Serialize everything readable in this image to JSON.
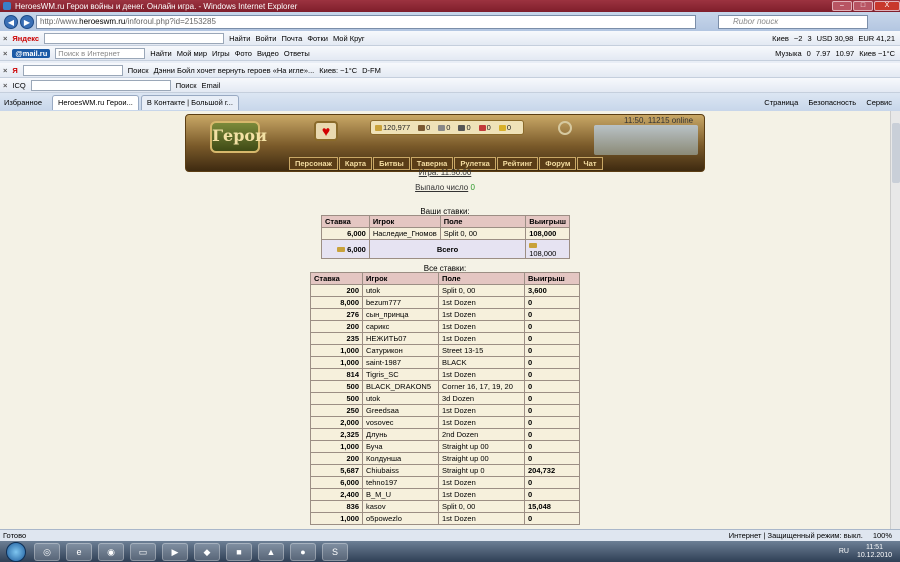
{
  "window": {
    "title": "HeroesWM.ru Герои войны и денег. Онлайн игра. - Windows Internet Explorer",
    "btn_min": "–",
    "btn_max": "□",
    "btn_close": "X"
  },
  "address": {
    "prefix": "http://www.",
    "domain": "heroeswm.ru",
    "path": "/inforoul.php?id=2153285",
    "search_placeholder": "Rubor поиск"
  },
  "toolbar1": {
    "brand": "Яндекс",
    "search_btn": "Найти",
    "items": [
      "Войти",
      "Почта",
      "Фотки",
      "Мой Круг"
    ],
    "weather": "Киев",
    "temp": "−2",
    "count": "3",
    "usd": "USD 30,98",
    "eur": "EUR 41,21"
  },
  "toolbar2": {
    "brand": "@mail.ru",
    "search_placeholder": "Поиск в Интернет",
    "search_btn": "Найти",
    "items": [
      "Мой мир",
      "Игры",
      "Фото",
      "Видео",
      "Ответы"
    ],
    "music": "Музыка",
    "count0": "0",
    "rate1": "7.97",
    "rate2": "10.97",
    "weather": "Киев −1°C"
  },
  "toolbar3": {
    "brand": "Я",
    "search": "Поиск",
    "news": "Дэнни Бойл хочет вернуть героев «На игле»...",
    "weather": "Киев: −1°C",
    "radio": "D-FM"
  },
  "toolbar4": {
    "icq": "ICQ",
    "search": "Поиск",
    "email": "Email"
  },
  "tabs": {
    "favorites": "Избранное",
    "tab1": "HeroesWM.ru Герои...",
    "tab2": "В Контакте | Большой г...",
    "tools": [
      "Страница",
      "Безопасность",
      "Сервис"
    ]
  },
  "game": {
    "logo": "Герои",
    "time_online": "11:50, 11215 online",
    "resources": [
      "120,977",
      "0",
      "0",
      "0",
      "0",
      "0"
    ],
    "menu": [
      "Персонаж",
      "Карта",
      "Битвы",
      "Таверна",
      "Рулетка",
      "Рейтинг",
      "Форум",
      "Чат"
    ]
  },
  "roulette": {
    "game_link": "Игра: 11:50:00",
    "dropped_label": "Выпало число",
    "dropped_value": "0"
  },
  "my_bets": {
    "title": "Ваши ставки:",
    "headers": [
      "Ставка",
      "Игрок",
      "Поле",
      "Выигрыш"
    ],
    "row": {
      "bet": "6,000",
      "player": "Наследие_Гномов",
      "field": "Split 0, 00",
      "win": "108,000"
    },
    "total": {
      "bet": "6,000",
      "label": "Всего",
      "win": "108,000"
    }
  },
  "all_bets": {
    "title": "Все ставки:",
    "headers": [
      "Ставка",
      "Игрок",
      "Поле",
      "Выигрыш"
    ],
    "rows": [
      [
        "200",
        "utok",
        "Split 0, 00",
        "3,600"
      ],
      [
        "8,000",
        "bezum777",
        "1st Dozen",
        "0"
      ],
      [
        "276",
        "сын_принца",
        "1st Dozen",
        "0"
      ],
      [
        "200",
        "сарикс",
        "1st Dozen",
        "0"
      ],
      [
        "235",
        "НЕЖИТЬ07",
        "1st Dozen",
        "0"
      ],
      [
        "1,000",
        "Сатурикон",
        "Street 13-15",
        "0"
      ],
      [
        "1,000",
        "saint-1987",
        "BLACK",
        "0"
      ],
      [
        "814",
        "Tigris_SC",
        "1st Dozen",
        "0"
      ],
      [
        "500",
        "BLACK_DRAKON5",
        "Corner 16, 17, 19, 20",
        "0"
      ],
      [
        "500",
        "utok",
        "3d Dozen",
        "0"
      ],
      [
        "250",
        "Greedsaa",
        "1st Dozen",
        "0"
      ],
      [
        "2,000",
        "vosovec",
        "1st Dozen",
        "0"
      ],
      [
        "2,325",
        "Длунь",
        "2nd Dozen",
        "0"
      ],
      [
        "1,000",
        "Буча",
        "Straight up 00",
        "0"
      ],
      [
        "200",
        "Колдунша",
        "Straight up 00",
        "0"
      ],
      [
        "5,687",
        "Chiubaiss",
        "Straight up 0",
        "204,732"
      ],
      [
        "6,000",
        "tehno197",
        "1st Dozen",
        "0"
      ],
      [
        "2,400",
        "B_M_U",
        "1st Dozen",
        "0"
      ],
      [
        "836",
        "kasov",
        "Split 0, 00",
        "15,048"
      ],
      [
        "1,000",
        "o5powezlo",
        "1st Dozen",
        "0"
      ]
    ]
  },
  "status": {
    "left": "Готово",
    "zone": "Интернет | Защищенный режим: выкл.",
    "zoom": "100%"
  },
  "taskbar": {
    "lang": "RU",
    "time": "11:51",
    "date": "10.12.2010"
  }
}
